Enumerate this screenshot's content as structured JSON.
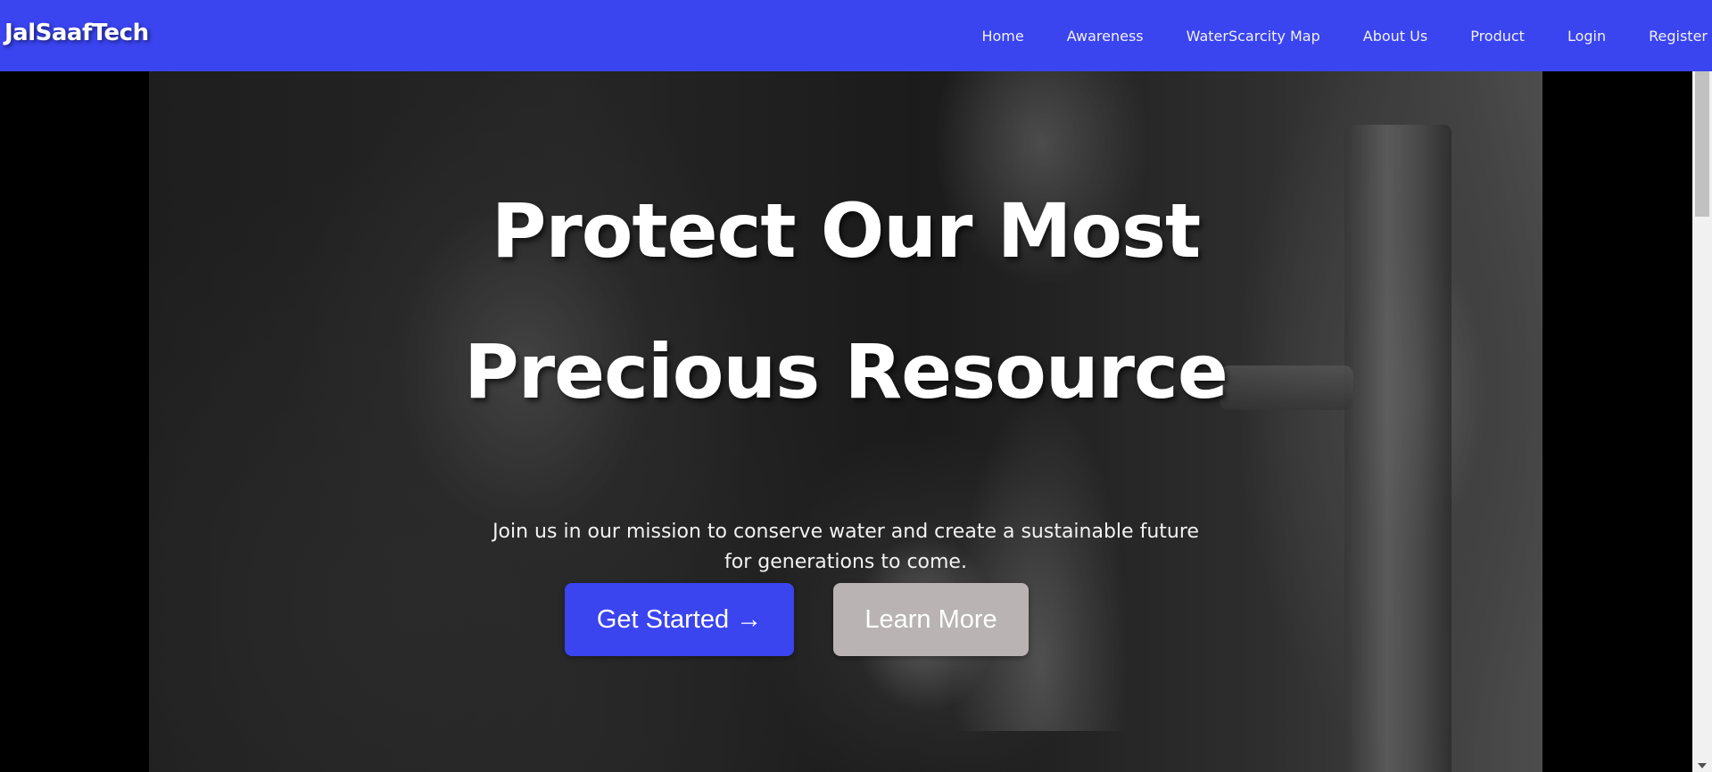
{
  "brand": "JalSaafTech",
  "nav": {
    "items": [
      {
        "label": "Home"
      },
      {
        "label": "Awareness"
      },
      {
        "label": "WaterScarcity Map"
      },
      {
        "label": "About Us"
      },
      {
        "label": "Product"
      },
      {
        "label": "Login"
      },
      {
        "label": "Register"
      }
    ]
  },
  "hero": {
    "title_line1": "Protect Our Most",
    "title_line2": "Precious Resource",
    "subtitle": "Join us in our mission to conserve water and create a sustainable future for generations to come.",
    "primary_button": "Get Started →",
    "secondary_button": "Learn More"
  },
  "colors": {
    "navbar": "#3a44ef",
    "primary_button": "#3a44ef",
    "secondary_button": "#b9b3b3"
  }
}
